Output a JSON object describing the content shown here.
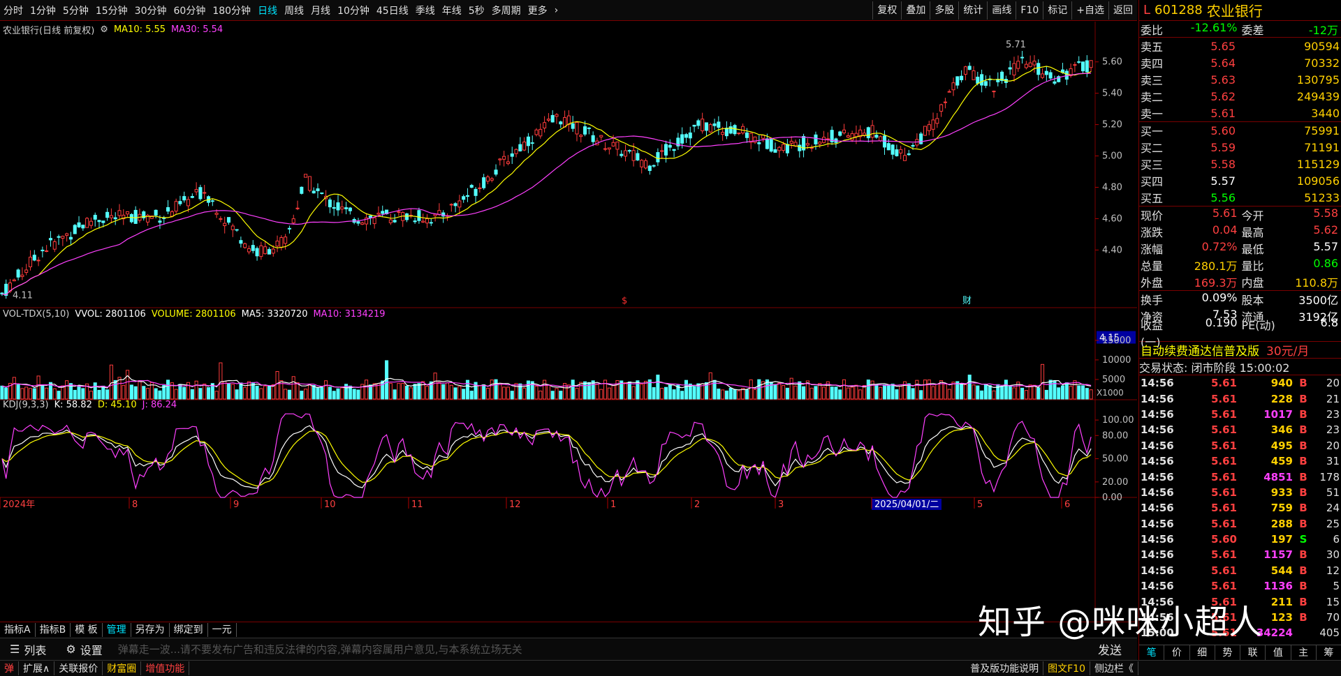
{
  "topbar": {
    "periods": [
      "分时",
      "1分钟",
      "5分钟",
      "15分钟",
      "30分钟",
      "60分钟",
      "180分钟",
      "日线",
      "周线",
      "月线",
      "10分钟",
      "45日线",
      "季线",
      "年线",
      "5秒",
      "多周期",
      "更多"
    ],
    "active_period": "日线",
    "tools": [
      "复权",
      "叠加",
      "多股",
      "统计",
      "画线",
      "F10",
      "标记",
      "+自选",
      "返回"
    ]
  },
  "chart": {
    "title": "农业银行(日线 前复权)",
    "ma10": "MA10: 5.55",
    "ma30": "MA30: 5.54",
    "high_mark": "5.71",
    "low_mark": "4.11",
    "price_ticks": [
      "5.60",
      "5.40",
      "5.20",
      "5.00",
      "4.80",
      "4.60",
      "4.40"
    ],
    "current_tag": "4.15",
    "marker_s": "$",
    "marker_cai": "财",
    "vol_legend": {
      "name": "VOL-TDX(5,10)",
      "vvol": "VVOL: 2801106",
      "volume": "VOLUME: 2801106",
      "ma5": "MA5: 3320720",
      "ma10": "MA10: 3134219"
    },
    "vol_ticks": [
      "15000",
      "10000",
      "5000"
    ],
    "vol_unit": "X1000",
    "kdj_legend": {
      "name": "KDJ(9,3,3)",
      "k": "K: 58.82",
      "d": "D: 45.10",
      "j": "J: 86.24"
    },
    "kdj_ticks": [
      "100.00",
      "80.00",
      "50.00",
      "20.00",
      "0.00"
    ],
    "date_labels": [
      "2024年",
      "8",
      "9",
      "10",
      "11",
      "12",
      "1",
      "2",
      "3",
      "2025/04/01/二",
      "5",
      "6"
    ]
  },
  "indbar": {
    "buttons": [
      "指标A",
      "指标B",
      "模 板",
      "管理",
      "另存为",
      "绑定到",
      "一元"
    ],
    "active": "管理"
  },
  "listbar": {
    "list_label": "列表",
    "settings_label": "设置",
    "marquee": "弹幕走一波...请不要发布广告和违反法律的内容,弹幕内容属用户意见,与本系统立场无关",
    "send": "发送"
  },
  "statusbar": {
    "items": [
      "弹",
      "扩展∧",
      "关联报价",
      "财富圈",
      "增值功能"
    ],
    "right": [
      "普及版功能说明",
      "图文F10",
      "侧边栏《"
    ]
  },
  "quote": {
    "code": "601288",
    "name": "农业银行",
    "weibi_label": "委比",
    "weibi": "-12.61%",
    "weicha_label": "委差",
    "weicha": "-12万",
    "asks": [
      {
        "label": "卖五",
        "price": "5.65",
        "vol": "90594"
      },
      {
        "label": "卖四",
        "price": "5.64",
        "vol": "70332"
      },
      {
        "label": "卖三",
        "price": "5.63",
        "vol": "130795"
      },
      {
        "label": "卖二",
        "price": "5.62",
        "vol": "249439"
      },
      {
        "label": "卖一",
        "price": "5.61",
        "vol": "3440"
      }
    ],
    "bids": [
      {
        "label": "买一",
        "price": "5.60",
        "vol": "75991"
      },
      {
        "label": "买二",
        "price": "5.59",
        "vol": "71191"
      },
      {
        "label": "买三",
        "price": "5.58",
        "vol": "115129"
      },
      {
        "label": "买四",
        "price": "5.57",
        "vol": "109056"
      },
      {
        "label": "买五",
        "price": "5.56",
        "vol": "51233"
      }
    ],
    "stats1": [
      {
        "l1": "现价",
        "v1": "5.61",
        "l2": "今开",
        "v2": "5.58"
      },
      {
        "l1": "涨跌",
        "v1": "0.04",
        "l2": "最高",
        "v2": "5.62"
      },
      {
        "l1": "涨幅",
        "v1": "0.72%",
        "l2": "最低",
        "v2": "5.57"
      },
      {
        "l1": "总量",
        "v1": "280.1万",
        "l2": "量比",
        "v2": "0.86"
      },
      {
        "l1": "外盘",
        "v1": "169.3万",
        "l2": "内盘",
        "v2": "110.8万"
      }
    ],
    "stats2": [
      {
        "l1": "换手",
        "v1": "0.09%",
        "l2": "股本",
        "v2": "3500亿"
      },
      {
        "l1": "净资",
        "v1": "7.53",
        "l2": "流通",
        "v2": "3192亿"
      },
      {
        "l1": "收益(一)",
        "v1": "0.190",
        "l2": "PE(动)",
        "v2": "6.8"
      }
    ],
    "ad": "自动续费通达信普及版",
    "ad_price": "30元/月",
    "trade_state": "交易状态: 闭市阶段 15:00:02",
    "ticks": [
      {
        "t": "14:56",
        "p": "5.61",
        "v": "940",
        "b": "B",
        "n": "20"
      },
      {
        "t": "14:56",
        "p": "5.61",
        "v": "228",
        "b": "B",
        "n": "21"
      },
      {
        "t": "14:56",
        "p": "5.61",
        "v": "1017",
        "b": "B",
        "n": "23"
      },
      {
        "t": "14:56",
        "p": "5.61",
        "v": "346",
        "b": "B",
        "n": "23"
      },
      {
        "t": "14:56",
        "p": "5.61",
        "v": "495",
        "b": "B",
        "n": "20"
      },
      {
        "t": "14:56",
        "p": "5.61",
        "v": "459",
        "b": "B",
        "n": "31"
      },
      {
        "t": "14:56",
        "p": "5.61",
        "v": "4851",
        "b": "B",
        "n": "178"
      },
      {
        "t": "14:56",
        "p": "5.61",
        "v": "933",
        "b": "B",
        "n": "51"
      },
      {
        "t": "14:56",
        "p": "5.61",
        "v": "759",
        "b": "B",
        "n": "24"
      },
      {
        "t": "14:56",
        "p": "5.61",
        "v": "288",
        "b": "B",
        "n": "25"
      },
      {
        "t": "14:56",
        "p": "5.60",
        "v": "197",
        "b": "S",
        "n": "6"
      },
      {
        "t": "14:56",
        "p": "5.61",
        "v": "1157",
        "b": "B",
        "n": "30"
      },
      {
        "t": "14:56",
        "p": "5.61",
        "v": "544",
        "b": "B",
        "n": "12"
      },
      {
        "t": "14:56",
        "p": "5.61",
        "v": "1136",
        "b": "B",
        "n": "5"
      },
      {
        "t": "14:56",
        "p": "5.61",
        "v": "211",
        "b": "B",
        "n": "15"
      },
      {
        "t": "14:56",
        "p": "5.61",
        "v": "123",
        "b": "B",
        "n": "70"
      },
      {
        "t": "15:00",
        "p": "5.61",
        "v": "34224",
        "b": "",
        "n": "405"
      }
    ],
    "bottom_tabs": [
      "笔",
      "价",
      "细",
      "势",
      "联",
      "值",
      "主",
      "筹"
    ]
  },
  "watermark": "知乎 @咪咪小超人"
}
